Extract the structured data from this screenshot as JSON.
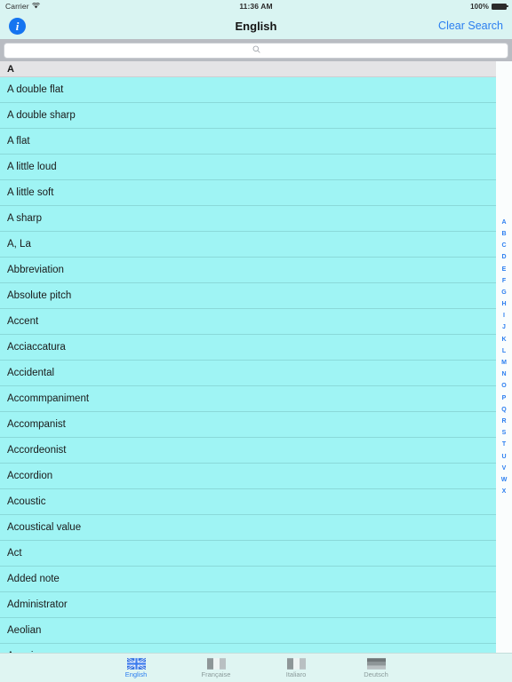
{
  "status_bar": {
    "carrier": "Carrier",
    "wifi_icon": "wifi-icon",
    "time": "11:36 AM",
    "battery_percent": "100%",
    "battery_icon": "battery-full-icon"
  },
  "nav_bar": {
    "info_button_label": "i",
    "info_icon": "info-circle-icon",
    "title": "English",
    "clear_search_label": "Clear Search"
  },
  "search": {
    "value": "",
    "placeholder": "",
    "icon": "search-icon",
    "glyph": "⚲"
  },
  "list": {
    "section_header": "A",
    "rows": [
      "A double flat",
      "A double sharp",
      "A flat",
      "A little loud",
      "A little soft",
      "A sharp",
      "A, La",
      "Abbreviation",
      "Absolute pitch",
      "Accent",
      "Acciaccatura",
      "Accidental",
      "Accommpaniment",
      "Accompanist",
      "Accordeonist",
      "Accordion",
      "Acoustic",
      "Acoustical value",
      "Act",
      "Added note",
      "Administrator",
      "Aeolian",
      "Agogic"
    ]
  },
  "index_strip": {
    "letters": [
      "A",
      "B",
      "C",
      "D",
      "E",
      "F",
      "G",
      "H",
      "I",
      "J",
      "K",
      "L",
      "M",
      "N",
      "O",
      "P",
      "Q",
      "R",
      "S",
      "T",
      "U",
      "V",
      "W",
      "X"
    ]
  },
  "tab_bar": {
    "tabs": [
      {
        "label": "English",
        "icon": "flag-uk-icon",
        "active": true
      },
      {
        "label": "Française",
        "icon": "flag-france-icon",
        "active": false
      },
      {
        "label": "Italiaro",
        "icon": "flag-italy-icon",
        "active": false
      },
      {
        "label": "Deutsch",
        "icon": "flag-germany-icon",
        "active": false
      }
    ]
  },
  "colors": {
    "row_background": "#9ff4f4",
    "section_header_background": "#e4e4e6",
    "nav_background": "#d9f4f2",
    "tab_background": "#dff5f2",
    "accent": "#2b7ef0",
    "search_bar_background": "#b9bcc2"
  }
}
